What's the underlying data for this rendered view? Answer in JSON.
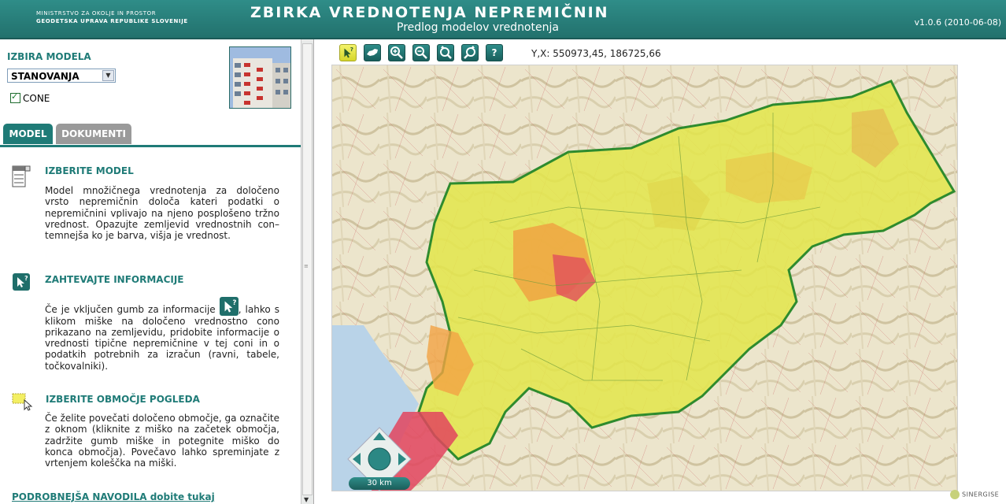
{
  "header": {
    "ministry_line1": "MINISTRSTVO ZA OKOLJE IN PROSTOR",
    "ministry_line2": "GEODETSKA UPRAVA REPUBLIKE SLOVENIJE",
    "title": "ZBIRKA VREDNOTENJA NEPREMIČNIN",
    "subtitle": "Predlog modelov vrednotenja",
    "version": "v1.0.6 (2010-06-08)"
  },
  "left": {
    "izbira_title": "IZBIRA MODELA",
    "select_value": "STANOVANJA",
    "cone_label": "CONE",
    "tabs": [
      "MODEL",
      "DOKUMENTI"
    ],
    "sections": [
      {
        "title": "IZBERITE MODEL",
        "text": "Model množičnega vrednotenja za določeno vrsto nepremičnin določa kateri podatki o nepremičnini vplivajo na njeno posplošeno tržno vrednost. Opazujte zemljevid vrednostnih con– temnejša ko je barva, višja je vrednost."
      },
      {
        "title": "ZAHTEVAJTE INFORMACIJE",
        "text_before": "Če je vključen gumb za informacije ",
        "text_after": ", lahko s klikom miške na določeno vrednostno cono prikazano na zemljevidu, pridobite informacije o vrednosti tipične nepremičnine v tej coni in o podatkih potrebnih za izračun (ravni, tabele, točkovalniki)."
      },
      {
        "title": "IZBERITE OBMOČJE POGLEDA",
        "text": "Če želite povečati določeno območje, ga označite z oknom (kliknite z miško na začetek območja, zadržite gumb miške in potegnite miško do konca območja). Povečavo lahko spreminjate z vrtenjem koleščka na miški."
      }
    ],
    "link": "PODROBNEJŠA NAVODILA dobite tukaj"
  },
  "toolbar": {
    "coords": "Y,X: 550973,45, 186725,66"
  },
  "map": {
    "scale_label": "30 km",
    "credit": "SINERGISE"
  }
}
